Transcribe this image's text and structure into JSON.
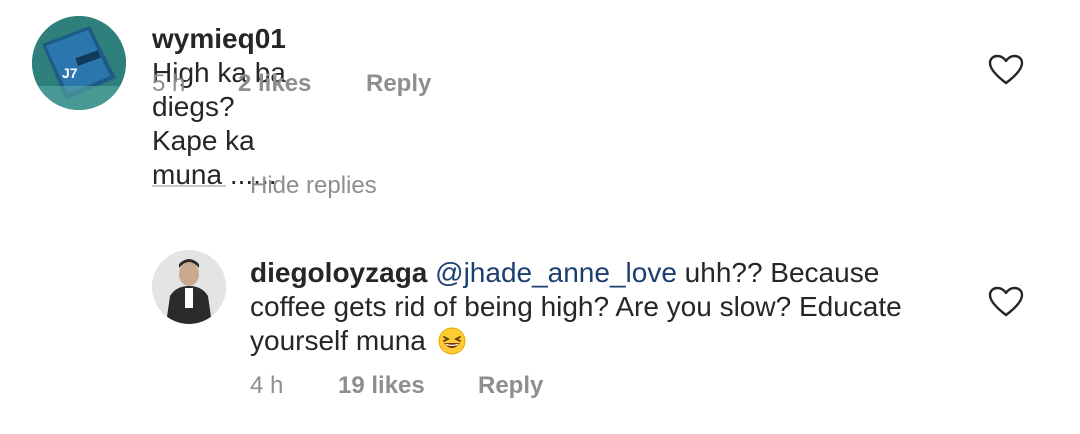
{
  "comments": [
    {
      "username": "wymieq01",
      "text": "High ka ba diegs? Kape ka muna ......",
      "time": "5 h",
      "likes": "2 likes",
      "reply_label": "Reply",
      "avatar_text": "J7"
    }
  ],
  "replies_toggle": {
    "label": "Hide replies"
  },
  "replies": [
    {
      "username": "diegoloyzaga",
      "mention": "@jhade_anne_love",
      "text_line1": " uhh?? Because",
      "text_line2": "coffee gets rid of being high? Are you slow? Educate",
      "text_line3": "yourself muna",
      "time": "4 h",
      "likes": "19 likes",
      "reply_label": "Reply"
    }
  ],
  "colors": {
    "text": "#262626",
    "meta": "#8e8e8e",
    "mention": "#1c3f72",
    "divider": "#c7c7c7"
  },
  "icons": {
    "like": "heart-outline-icon",
    "emoji": "grinning-squinting-face-emoji"
  }
}
